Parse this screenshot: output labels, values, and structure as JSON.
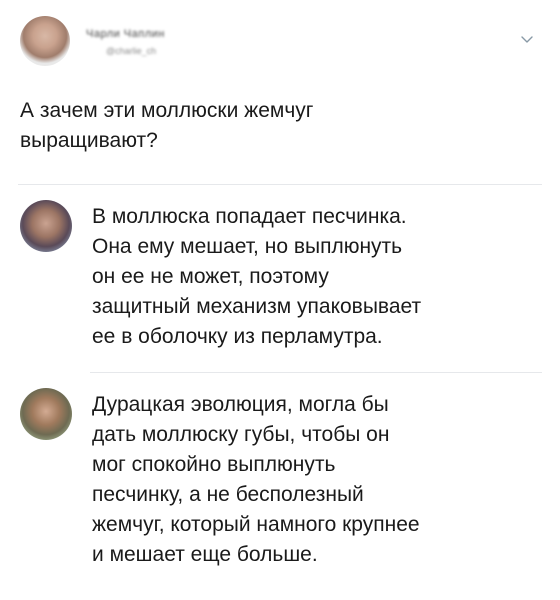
{
  "post": {
    "author_name": "Чарли Чаплин",
    "author_handle": "@charlie_ch",
    "text": "А зачем эти моллюски жемчуг\nвыращивают?"
  },
  "replies": [
    {
      "text": "В моллюска попадает песчинка.\nОна ему мешает, но выплюнуть\nон ее не может, поэтому\nзащитный механизм упаковывает\nее в оболочку из перламутра."
    },
    {
      "text": "Дурацкая эволюция, могла бы\nдать моллюску губы, чтобы он\nмог спокойно выплюнуть\nпесчинку, а не бесполезный\nжемчуг, который намного крупнее\nи мешает еще больше."
    }
  ],
  "icons": {
    "menu": "chevron-down-icon"
  },
  "colors": {
    "text": "#1a1a1a",
    "divider": "#e6e8eb",
    "chevron": "#8899a6"
  }
}
